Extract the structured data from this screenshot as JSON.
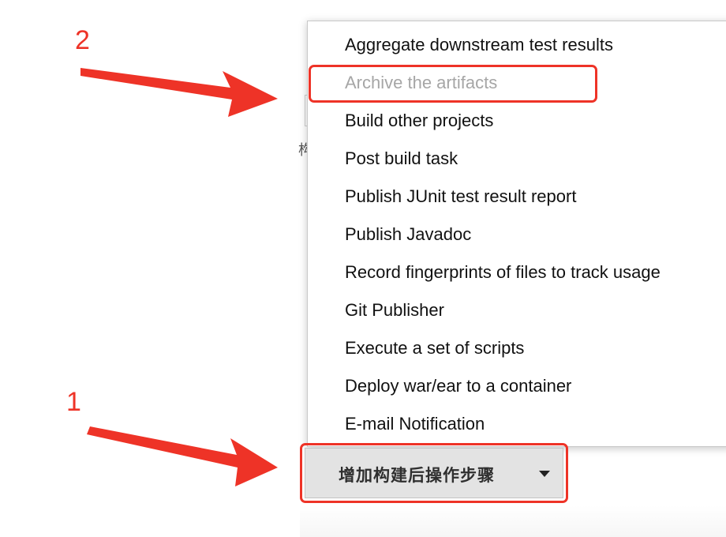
{
  "background": {
    "partial_char": "构"
  },
  "menu": {
    "items": [
      {
        "label": "Aggregate downstream test results",
        "disabled": false
      },
      {
        "label": "Archive the artifacts",
        "disabled": true
      },
      {
        "label": "Build other projects",
        "disabled": false
      },
      {
        "label": "Post build task",
        "disabled": false
      },
      {
        "label": "Publish JUnit test result report",
        "disabled": false
      },
      {
        "label": "Publish Javadoc",
        "disabled": false
      },
      {
        "label": "Record fingerprints of files to track usage",
        "disabled": false
      },
      {
        "label": "Git Publisher",
        "disabled": false
      },
      {
        "label": "Execute a set of scripts",
        "disabled": false
      },
      {
        "label": "Deploy war/ear to a container",
        "disabled": false
      },
      {
        "label": "E-mail Notification",
        "disabled": false
      }
    ]
  },
  "add_step_button": {
    "label": "增加构建后操作步骤",
    "icon": "caret-down-icon"
  },
  "annotations": {
    "step_1": "1",
    "step_2": "2",
    "color": "#ee3327"
  }
}
